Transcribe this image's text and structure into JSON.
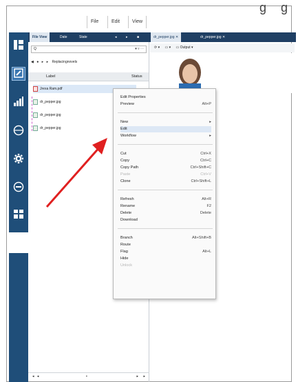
{
  "menubar": {
    "items": [
      "File",
      "Edit",
      "View"
    ]
  },
  "partial_title_glyphs": "g g",
  "sidebar": {
    "icons": [
      "dashboard-icon",
      "edit-icon",
      "chart-icon",
      "globe-icon",
      "gear-icon",
      "circle-icon",
      "people-icon"
    ]
  },
  "pane_tabs": [
    "File View",
    "Date",
    "State"
  ],
  "doc_tabs": [
    "dr_pepper.jpg",
    "dr_pepper.jpg"
  ],
  "search": {
    "value": "Q"
  },
  "nav": {
    "path": "Replacingnovels"
  },
  "table": {
    "headers": [
      "Label",
      "Status"
    ],
    "rows": [
      "Jrexa Ram.pdf",
      "dr_pepper.jpg",
      "dr_pepper.jpg",
      "dr_pepper.jpg"
    ]
  },
  "doc_toolbar": {
    "output_label": "Output"
  },
  "context_menu": {
    "groups": [
      [
        {
          "label": "Edit Properties",
          "shortcut": "",
          "disabled": false
        },
        {
          "label": "Preview",
          "shortcut": "Alt+P",
          "disabled": false
        }
      ],
      [
        {
          "label": "New",
          "shortcut": "▸",
          "disabled": false
        },
        {
          "label": "Edit",
          "shortcut": "",
          "disabled": false
        },
        {
          "label": "Workflow",
          "shortcut": "▸",
          "disabled": false
        }
      ],
      [
        {
          "label": "Cut",
          "shortcut": "Ctrl+X",
          "disabled": false
        },
        {
          "label": "Copy",
          "shortcut": "Ctrl+C",
          "disabled": false
        },
        {
          "label": "Copy Path",
          "shortcut": "Ctrl+Shift+C",
          "disabled": false
        },
        {
          "label": "Paste",
          "shortcut": "Ctrl+V",
          "disabled": true
        },
        {
          "label": "Clone",
          "shortcut": "Ctrl+Shift+L",
          "disabled": false
        }
      ],
      [
        {
          "label": "Refresh",
          "shortcut": "Alt+R",
          "disabled": false
        },
        {
          "label": "Rename",
          "shortcut": "F2",
          "disabled": false
        },
        {
          "label": "Delete",
          "shortcut": "Delete",
          "disabled": false
        },
        {
          "label": "Download",
          "shortcut": "",
          "disabled": false
        }
      ],
      [
        {
          "label": "Branch",
          "shortcut": "Alt+Shift+B",
          "disabled": false
        },
        {
          "label": "Route",
          "shortcut": "",
          "disabled": false
        },
        {
          "label": "Flag",
          "shortcut": "Alt+L",
          "disabled": false
        },
        {
          "label": "Hide",
          "shortcut": "",
          "disabled": false
        },
        {
          "label": "Unlock",
          "shortcut": "",
          "disabled": true
        }
      ]
    ]
  },
  "colors": {
    "sidebar": "#1f4e79",
    "tab_bar": "#1f3f63",
    "arrow": "#e02020"
  }
}
